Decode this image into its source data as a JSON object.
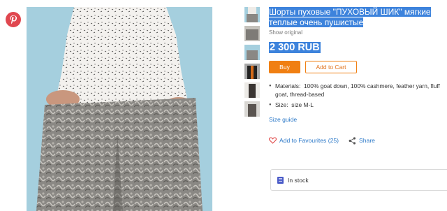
{
  "icons": {
    "pinterest": "pinterest-icon",
    "heart": "heart-icon",
    "share": "share-icon",
    "stock": "box-icon"
  },
  "colors": {
    "accent": "#f07f12",
    "link": "#2b78c8",
    "selection": "#3d83dc",
    "pinterest": "#e0474f"
  },
  "product": {
    "title": "Шорты пуховые \"ПУХОВЫЙ ШИК\" мягкие теплые очень пушистые",
    "show_original": "Show original",
    "price": "2 300 RUB",
    "buy_label": "Buy",
    "cart_label": "Add to Cart",
    "specs": [
      {
        "label": "Materials:",
        "value": "100% goat down, 100% cashmere, feather yarn, fluff goat, thread-based"
      },
      {
        "label": "Size:",
        "value": "size M-L"
      }
    ],
    "size_guide": "Size guide",
    "favourites": "Add to Favourites (25)",
    "share": "Share",
    "stock": "In stock"
  }
}
